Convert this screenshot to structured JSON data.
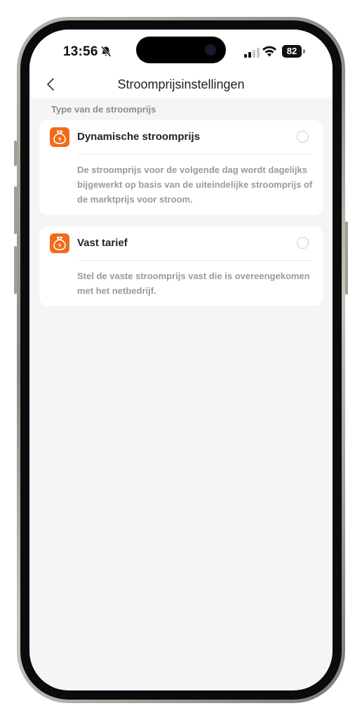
{
  "status_bar": {
    "time": "13:56",
    "battery": "82",
    "icons": [
      "bell-slash-icon",
      "cellular-signal-icon",
      "wifi-icon",
      "battery-icon"
    ]
  },
  "navbar": {
    "back_icon": "chevron-left-icon",
    "title": "Stroomprijsinstellingen"
  },
  "section": {
    "label": "Type van de stroomprijs"
  },
  "options": [
    {
      "icon": "money-bag-bolt-icon",
      "title": "Dynamische stroomprijs",
      "description": "De stroomprijs voor de volgende dag wordt dagelijks bijgewerkt op basis van de uiteindelijke stroomprijs of de marktprijs voor stroom.",
      "selected": false
    },
    {
      "icon": "money-bag-bolt-icon",
      "title": "Vast tarief",
      "description": "Stel de vaste stroomprijs vast die is overeengekomen met het netbedrijf.",
      "selected": false
    }
  ],
  "colors": {
    "accent": "#f26a1b",
    "background": "#f5f5f5",
    "card": "#ffffff",
    "title_text": "#222222",
    "secondary_text": "#9a9a9a"
  }
}
